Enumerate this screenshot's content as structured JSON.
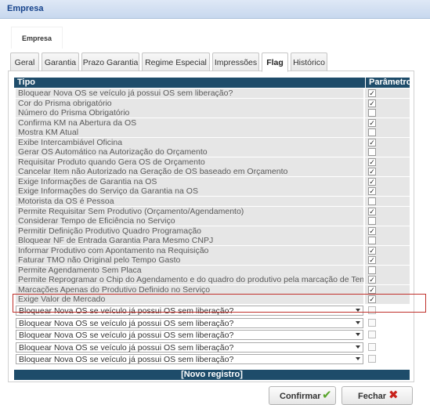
{
  "window": {
    "title": "Empresa"
  },
  "section_tab": {
    "label": "Empresa"
  },
  "tabs": [
    {
      "label": "Geral",
      "active": false
    },
    {
      "label": "Garantia",
      "active": false
    },
    {
      "label": "Prazo Garantia",
      "active": false
    },
    {
      "label": "Regime Especial",
      "active": false
    },
    {
      "label": "Impressões",
      "active": false
    },
    {
      "label": "Flag",
      "active": true
    },
    {
      "label": "Histórico",
      "active": false
    }
  ],
  "table": {
    "col_tipo": "Tipo",
    "col_parametro": "Parâmetro",
    "rows": [
      {
        "label": "Bloquear Nova OS se veículo já possui OS sem liberação?",
        "checked": true
      },
      {
        "label": "Cor do Prisma obrigatório",
        "checked": true
      },
      {
        "label": "Número do Prisma Obrigatório",
        "checked": false
      },
      {
        "label": "Confirma KM na Abertura da OS",
        "checked": true
      },
      {
        "label": "Mostra KM Atual",
        "checked": false
      },
      {
        "label": "Exibe Intercambiável Oficina",
        "checked": true
      },
      {
        "label": "Gerar OS Automático na Autorização do Orçamento",
        "checked": false
      },
      {
        "label": "Requisitar Produto quando Gera OS de Orçamento",
        "checked": true
      },
      {
        "label": "Cancelar Item não Autorizado na Geração de OS baseado em Orçamento",
        "checked": true
      },
      {
        "label": "Exige Informações de Garantia na OS",
        "checked": true
      },
      {
        "label": "Exige Informações do Serviço da Garantia na OS",
        "checked": true
      },
      {
        "label": "Motorista da OS é Pessoa",
        "checked": false
      },
      {
        "label": "Permite Requisitar Sem Produtivo (Orçamento/Agendamento)",
        "checked": true
      },
      {
        "label": "Considerar Tempo de Eficiência no Serviço",
        "checked": false
      },
      {
        "label": "Permitir Definição Produtivo Quadro Programação",
        "checked": true
      },
      {
        "label": "Bloquear NF de Entrada Garantia Para Mesmo CNPJ",
        "checked": false
      },
      {
        "label": "Informar Produtivo com Apontamento na Requisição",
        "checked": true
      },
      {
        "label": "Faturar TMO não Original pelo Tempo Gasto",
        "checked": true
      },
      {
        "label": "Permite Agendamento Sem Placa",
        "checked": false
      },
      {
        "label": "Permite Reprogramar o Chip do Agendamento e do quadro do produtivo pela marcação de Tempo",
        "checked": true
      },
      {
        "label": "Marcações Apenas do Produtivo Definido no Serviço",
        "checked": true
      },
      {
        "label": "Exige Valor de Mercado",
        "checked": true
      }
    ],
    "new_rows": [
      {
        "value": "Bloquear Nova OS se veículo já possui OS sem liberação?",
        "checked": false
      },
      {
        "value": "Bloquear Nova OS se veículo já possui OS sem liberação?",
        "checked": false
      },
      {
        "value": "Bloquear Nova OS se veículo já possui OS sem liberação?",
        "checked": false
      },
      {
        "value": "Bloquear Nova OS se veículo já possui OS sem liberação?",
        "checked": false
      },
      {
        "value": "Bloquear Nova OS se veículo já possui OS sem liberação?",
        "checked": false
      }
    ],
    "new_record_label": "[Novo registro]"
  },
  "buttons": {
    "confirm": {
      "label": "Confirmar",
      "icon": "check-icon"
    },
    "close": {
      "label": "Fechar",
      "icon": "close-icon"
    }
  },
  "colors": {
    "header_bg": "#1e4c6a",
    "highlight_border": "#c0302b",
    "confirm_icon": "#58a52a",
    "close_icon": "#c8221c"
  }
}
